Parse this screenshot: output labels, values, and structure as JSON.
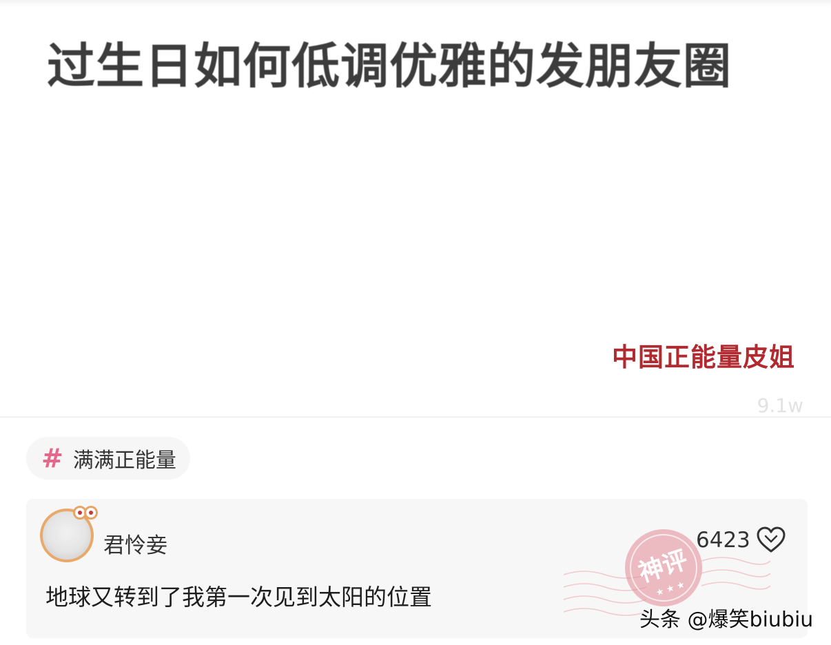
{
  "video": {
    "title": "过生日如何低调优雅的发朋友圈",
    "author_watermark": "中国正能量皮姐",
    "faded_counter": "9.1w"
  },
  "topic": {
    "icon": "hash-icon",
    "symbol": "#",
    "label": "满满正能量",
    "accent_color": "#e5678a"
  },
  "comment": {
    "username": "君怜妾",
    "text": "地球又转到了我第一次见到太阳的位置",
    "like_count": "6423",
    "like_icon": "heart-outline-icon",
    "stamp_icon": "featured-comment-stamp-icon",
    "stamp_label": "神评",
    "stamp_color": "#e38b95"
  },
  "platform_watermark": "头条 @爆笑biubiu"
}
